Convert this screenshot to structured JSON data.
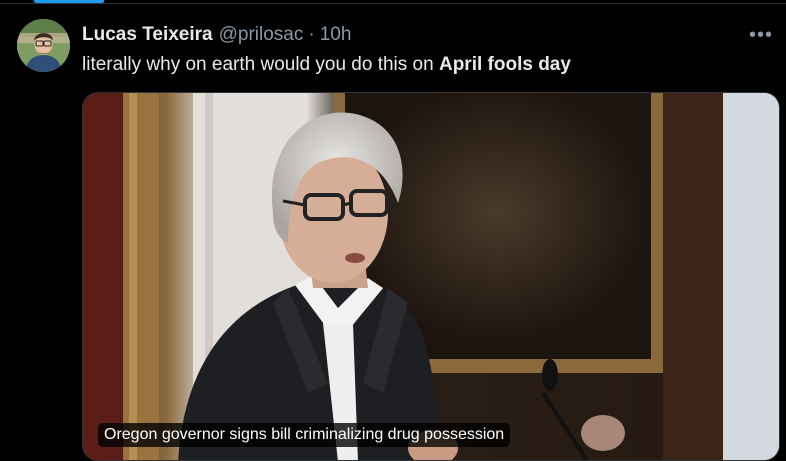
{
  "tweet": {
    "author_name": "Lucas Teixeira",
    "handle": "@prilosac",
    "separator": "·",
    "time": "10h",
    "more_icon": "more-horizontal-icon",
    "text_prefix": "literally why on earth would you do this on ",
    "text_bold": "April fools day",
    "media": {
      "caption": "Oregon governor signs bill criminalizing drug possession"
    }
  },
  "colors": {
    "background": "#000000",
    "text_primary": "#e7e9ea",
    "text_secondary": "#8b98a5",
    "accent": "#1d9bf0",
    "divider": "#2f3336"
  }
}
